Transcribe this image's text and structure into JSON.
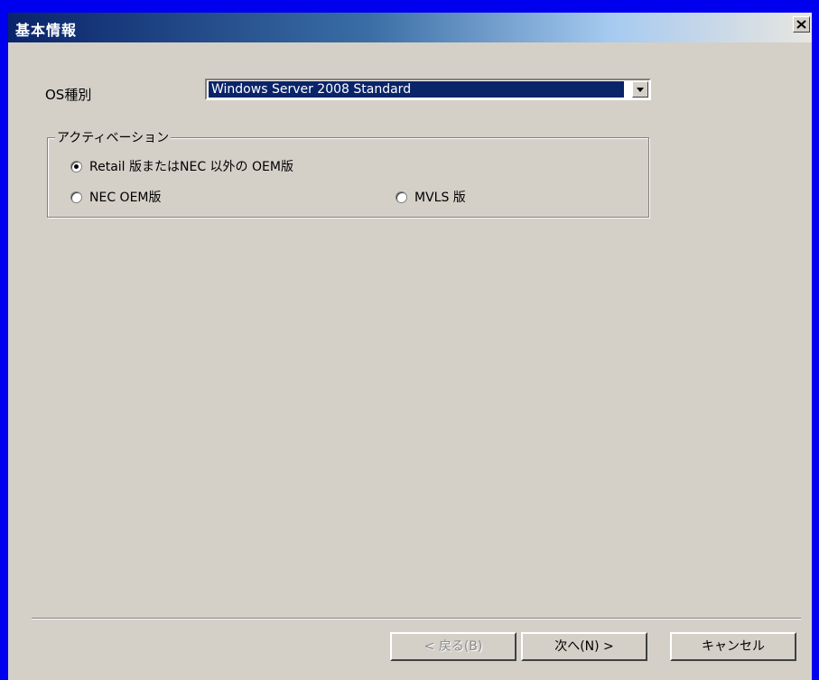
{
  "window": {
    "title": "基本情報"
  },
  "os_type": {
    "label": "OS種別",
    "selected": "Windows Server 2008 Standard"
  },
  "activation": {
    "legend": "アクティベーション",
    "options": [
      {
        "label": "Retail 版またはNEC 以外の OEM版",
        "selected": true
      },
      {
        "label": "NEC OEM版",
        "selected": false
      },
      {
        "label": "MVLS 版",
        "selected": false
      }
    ]
  },
  "buttons": {
    "back": "< 戻る(B)",
    "next": "次へ(N) >",
    "cancel": "キャンセル"
  }
}
